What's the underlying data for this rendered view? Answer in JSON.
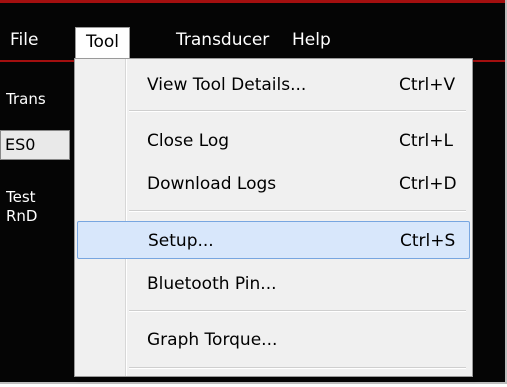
{
  "menubar": {
    "items": [
      {
        "label": "File"
      },
      {
        "label": "Tool"
      },
      {
        "label": "Transducer"
      },
      {
        "label": "Help"
      }
    ]
  },
  "left_panel": {
    "transducer_label": "Trans",
    "combo_value": "ES0",
    "test_label": "Test",
    "rnd_label": "RnD"
  },
  "tool_menu": {
    "items": [
      {
        "label": "View Tool Details...",
        "shortcut": "Ctrl+V"
      },
      {
        "label": "Close Log",
        "shortcut": "Ctrl+L"
      },
      {
        "label": "Download Logs",
        "shortcut": "Ctrl+D"
      },
      {
        "label": "Setup...",
        "shortcut": "Ctrl+S"
      },
      {
        "label": "Bluetooth Pin...",
        "shortcut": ""
      },
      {
        "label": "Graph Torque...",
        "shortcut": ""
      }
    ]
  },
  "colors": {
    "window_bg": "#050505",
    "accent_line": "#a30f0f",
    "menu_bg": "#f0f0f0",
    "highlight_bg": "#d8e7fb",
    "highlight_border": "#78a6e0"
  }
}
